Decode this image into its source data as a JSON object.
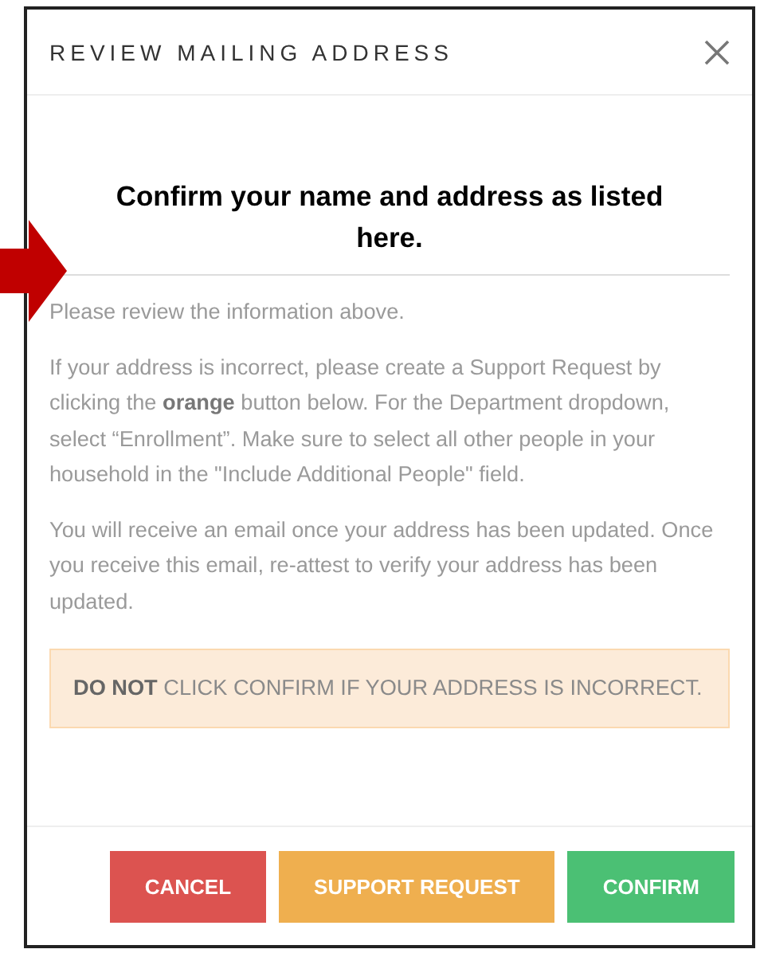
{
  "dialog": {
    "title": "REVIEW MAILING ADDRESS",
    "callout": "Confirm your name and address as listed here.",
    "paragraphs": [
      "Please review the information above.",
      "If your address is incorrect, please create a Support Request by clicking the **orange** button below. For the Department dropdown, select “Enrollment”. Make sure to select all other people in your household in the \"Include Additional People\" field.",
      "You will receive an email once your address has been updated. Once you receive this email, re-attest to verify your address has been updated."
    ],
    "notice": "**DO NOT** CLICK CONFIRM IF YOUR ADDRESS IS INCORRECT.",
    "buttons": [
      {
        "label": "CANCEL",
        "kind": "cancel"
      },
      {
        "label": "SUPPORT REQUEST",
        "kind": "support"
      },
      {
        "label": "CONFIRM",
        "kind": "confirm"
      }
    ]
  }
}
